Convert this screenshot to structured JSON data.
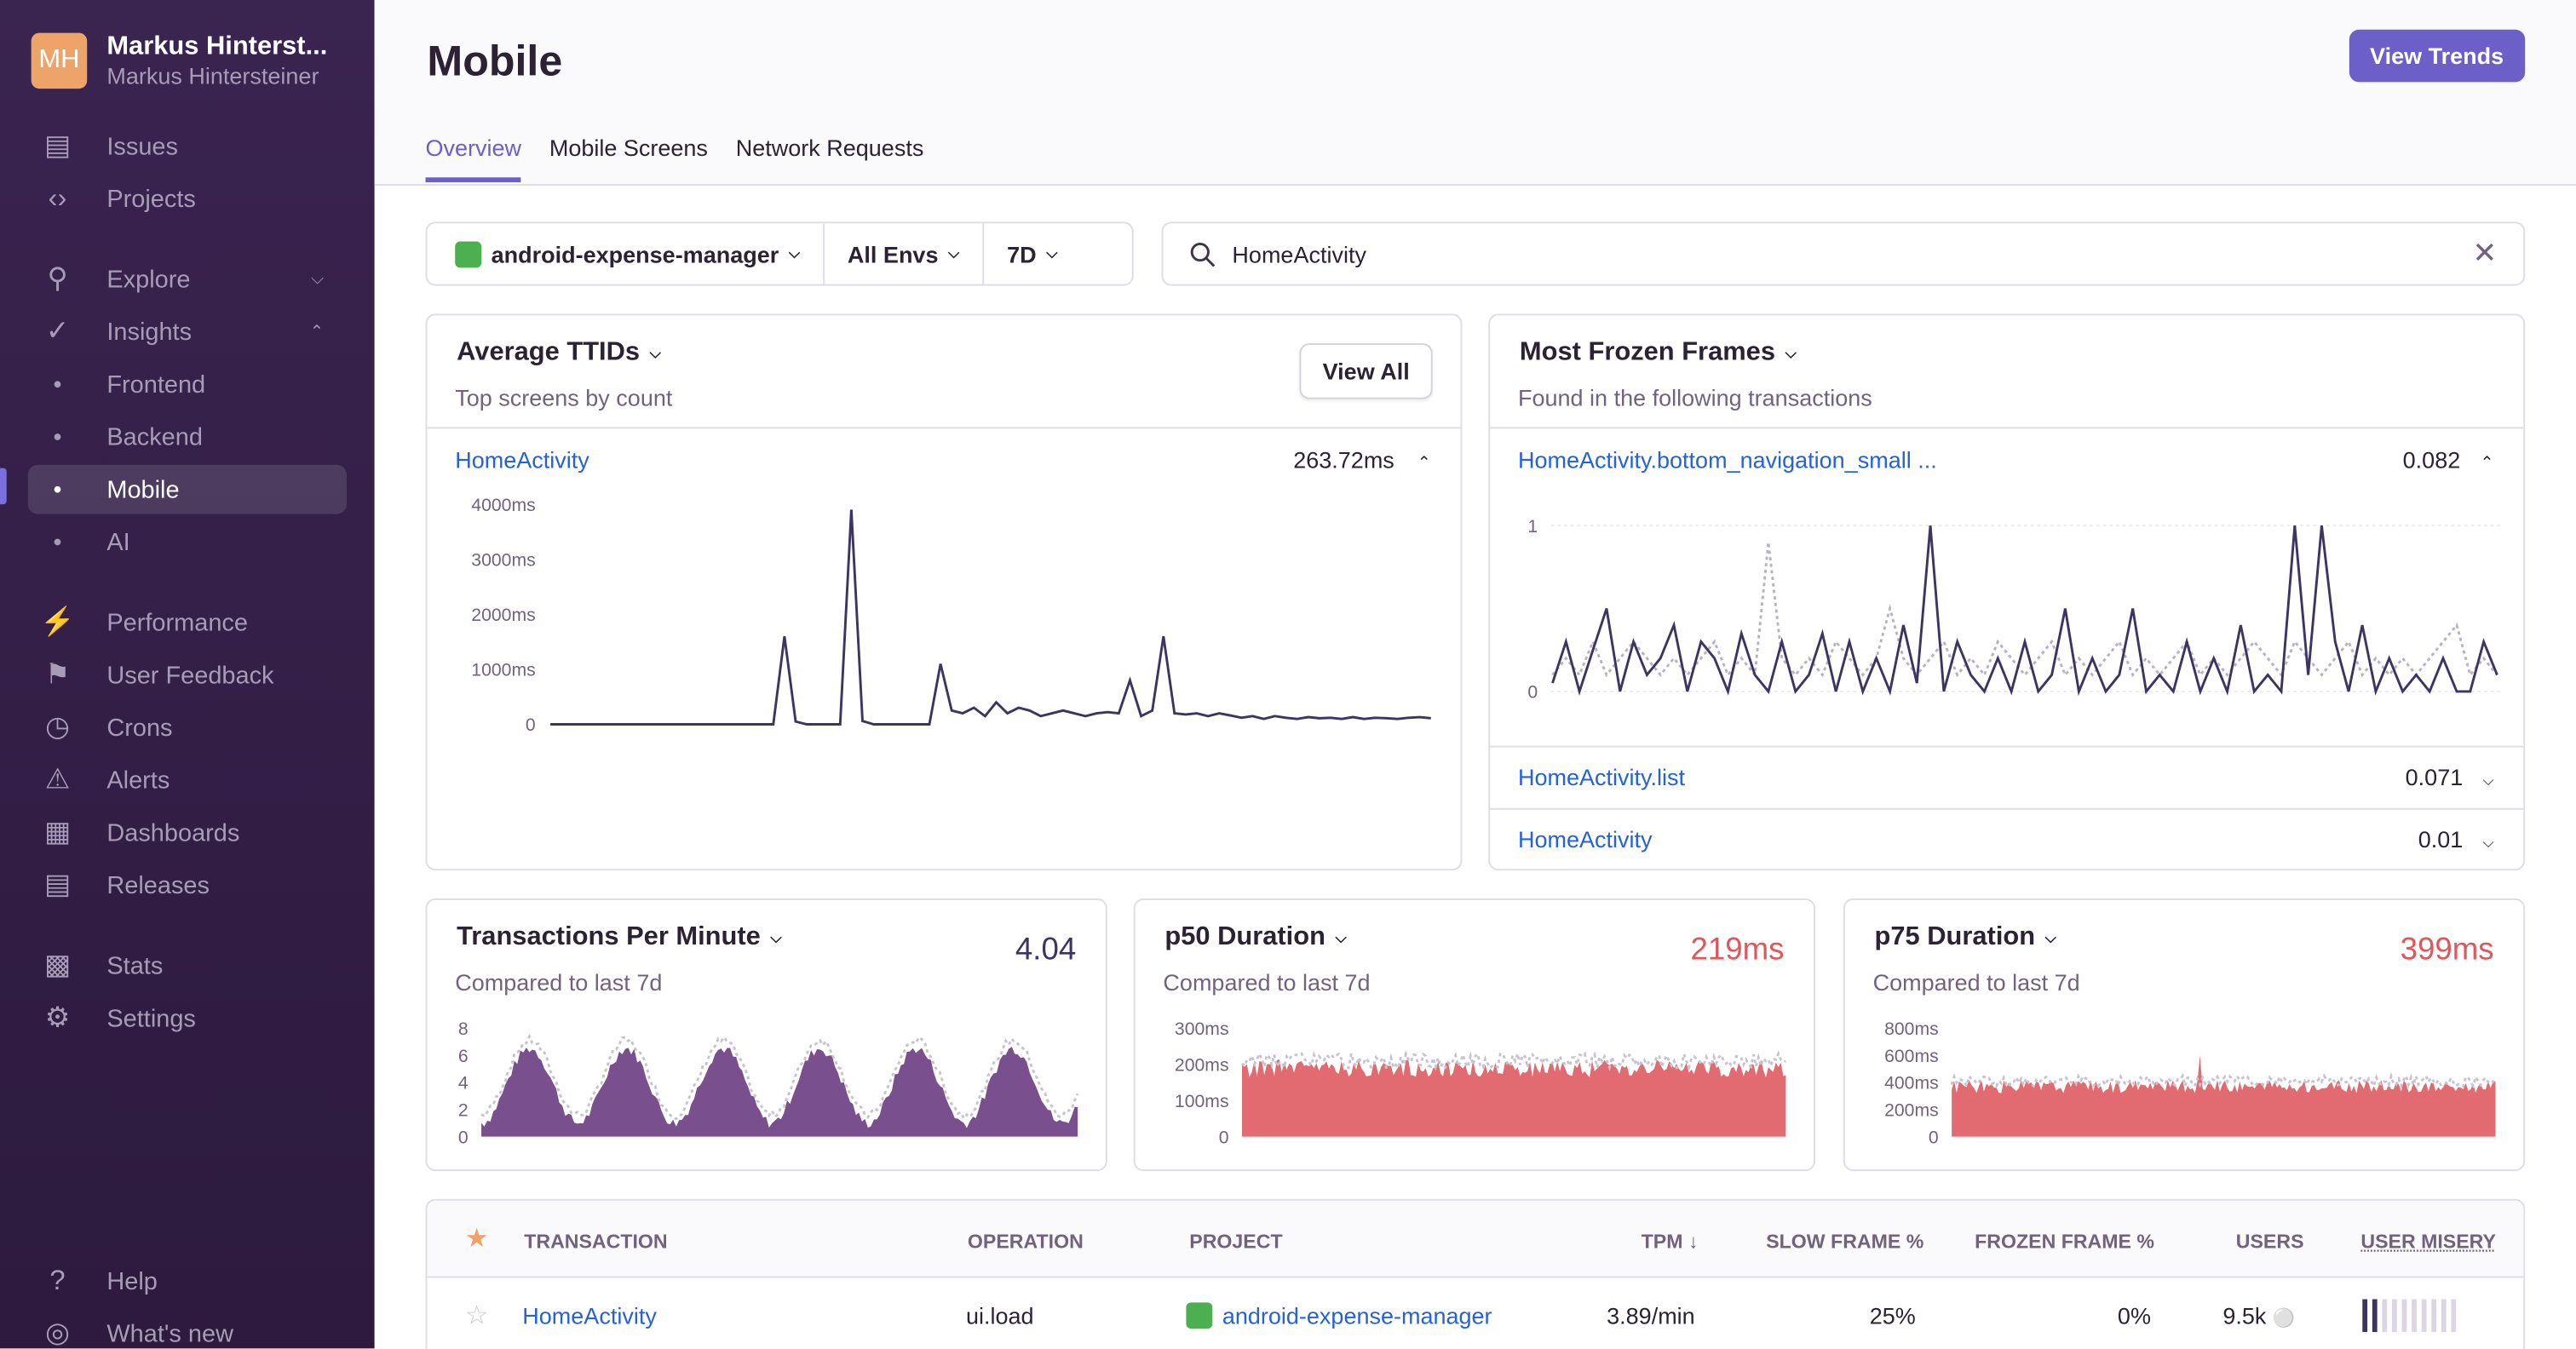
{
  "org": {
    "initials": "MH",
    "name": "Markus Hinterst...",
    "user": "Markus Hintersteiner"
  },
  "sidebar": {
    "items": [
      {
        "label": "Issues",
        "icon": "inbox-icon"
      },
      {
        "label": "Projects",
        "icon": "folder-code-icon"
      },
      {
        "label": "Explore",
        "icon": "search-icon",
        "chevron": "down"
      },
      {
        "label": "Insights",
        "icon": "insights-icon",
        "chevron": "up"
      },
      {
        "label": "Frontend",
        "sub": true
      },
      {
        "label": "Backend",
        "sub": true
      },
      {
        "label": "Mobile",
        "sub": true,
        "active": true
      },
      {
        "label": "AI",
        "sub": true
      },
      {
        "label": "Performance",
        "icon": "lightning-icon"
      },
      {
        "label": "User Feedback",
        "icon": "megaphone-icon"
      },
      {
        "label": "Crons",
        "icon": "history-icon"
      },
      {
        "label": "Alerts",
        "icon": "siren-icon"
      },
      {
        "label": "Dashboards",
        "icon": "dashboard-icon"
      },
      {
        "label": "Releases",
        "icon": "releases-icon"
      },
      {
        "label": "Stats",
        "icon": "stats-icon"
      },
      {
        "label": "Settings",
        "icon": "gear-icon"
      },
      {
        "label": "Help",
        "icon": "question-icon"
      },
      {
        "label": "What's new",
        "icon": "broadcast-icon"
      }
    ]
  },
  "header": {
    "title": "Mobile",
    "view_trends": "View Trends",
    "tabs": [
      "Overview",
      "Mobile Screens",
      "Network Requests"
    ],
    "selected_tab": "Overview"
  },
  "filters": {
    "project": "android-expense-manager",
    "env": "All Envs",
    "period": "7D"
  },
  "search": {
    "value": "HomeActivity"
  },
  "colors": {
    "accent": "#6c5fc7",
    "line": "#3e3460",
    "area_purple": "#7a4f8e",
    "area_red": "#e16b71",
    "red_value": "#e0575b",
    "link": "#2562d4"
  },
  "ttid": {
    "title": "Average TTIDs",
    "subtitle": "Top screens by count",
    "view_all": "View All",
    "row_label": "HomeActivity",
    "row_value": "263.72ms"
  },
  "frozen": {
    "title": "Most Frozen Frames",
    "subtitle": "Found in the following transactions",
    "rows": [
      {
        "label": "HomeActivity.bottom_navigation_small ...",
        "value": "0.082",
        "expanded": true
      },
      {
        "label": "HomeActivity.list",
        "value": "0.071"
      },
      {
        "label": "HomeActivity",
        "value": "0.01"
      }
    ]
  },
  "tpm": {
    "title": "Transactions Per Minute",
    "subtitle": "Compared to last 7d",
    "value": "4.04"
  },
  "p50": {
    "title": "p50 Duration",
    "subtitle": "Compared to last 7d",
    "value": "219ms"
  },
  "p75": {
    "title": "p75 Duration",
    "subtitle": "Compared to last 7d",
    "value": "399ms"
  },
  "table": {
    "headers": [
      "TRANSACTION",
      "OPERATION",
      "PROJECT",
      "TPM",
      "SLOW FRAME %",
      "FROZEN FRAME %",
      "USERS",
      "USER MISERY"
    ],
    "rows": [
      {
        "transaction": "HomeActivity",
        "operation": "ui.load",
        "project": "android-expense-manager",
        "tpm": "3.89/min",
        "slow": "25%",
        "frozen": "0%",
        "users": "9.5k",
        "misery_level": 0.2,
        "starred": false
      }
    ]
  },
  "chart_data": [
    {
      "type": "line",
      "id": "ttid",
      "yticks": [
        "4000ms",
        "3000ms",
        "2000ms",
        "1000ms",
        "0"
      ],
      "ylim": [
        0,
        4000
      ],
      "values": [
        0,
        0,
        0,
        0,
        0,
        0,
        0,
        0,
        0,
        0,
        0,
        0,
        0,
        0,
        0,
        0,
        0,
        0,
        0,
        0,
        0,
        1600,
        50,
        0,
        0,
        0,
        0,
        3900,
        60,
        0,
        0,
        0,
        0,
        0,
        0,
        1100,
        250,
        200,
        300,
        150,
        400,
        200,
        300,
        250,
        150,
        200,
        250,
        200,
        150,
        200,
        220,
        200,
        800,
        150,
        250,
        1600,
        200,
        180,
        200,
        150,
        200,
        160,
        120,
        150,
        100,
        150,
        120,
        100,
        130,
        110,
        120,
        100,
        130,
        100,
        120,
        110,
        100,
        120,
        130,
        110
      ]
    },
    {
      "type": "line",
      "id": "frozen",
      "yticks": [
        "1",
        "0"
      ],
      "ylim": [
        0,
        1
      ],
      "series": [
        {
          "values": [
            0.05,
            0.3,
            0,
            0.25,
            0.5,
            0,
            0.3,
            0.1,
            0.2,
            0.4,
            0,
            0.3,
            0.2,
            0,
            0.35,
            0.1,
            0,
            0.3,
            0,
            0.1,
            0.35,
            0,
            0.3,
            0,
            0.2,
            0,
            0.4,
            0.05,
            1,
            0,
            0.3,
            0.1,
            0,
            0.2,
            0,
            0.3,
            0,
            0.1,
            0.5,
            0,
            0.2,
            0,
            0.1,
            0.5,
            0,
            0.1,
            0,
            0.3,
            0,
            0.2,
            0,
            0.4,
            0,
            0.1,
            0,
            1,
            0.1,
            1,
            0.3,
            0,
            0.4,
            0,
            0.2,
            0,
            0.1,
            0,
            0.2,
            0,
            0,
            0.3,
            0.1
          ],
          "style": "solid"
        },
        {
          "values": [
            0.1,
            0.2,
            0.1,
            0.3,
            0.1,
            0.2,
            0.3,
            0.2,
            0.1,
            0.2,
            0.1,
            0.2,
            0.3,
            0.1,
            0.2,
            0.1,
            0.9,
            0.2,
            0.1,
            0.2,
            0.1,
            0.3,
            0.2,
            0.1,
            0.2,
            0.5,
            0.2,
            0.1,
            0.2,
            0.3,
            0.1,
            0.2,
            0.1,
            0.3,
            0.2,
            0.1,
            0.2,
            0.3,
            0.1,
            0.2,
            0.1,
            0.2,
            0.3,
            0.1,
            0.2,
            0.1,
            0.2,
            0.3,
            0.1,
            0.2,
            0.1,
            0.2,
            0.3,
            0.2,
            0.1,
            0.3,
            0.2,
            0.1,
            0.2,
            0.3,
            0.1,
            0.2,
            0.1,
            0.2,
            0.1,
            0.2,
            0.3,
            0.4,
            0.1,
            0.2,
            0.1
          ],
          "style": "dotted"
        }
      ]
    },
    {
      "type": "area",
      "id": "tpm",
      "yticks": [
        "8",
        "6",
        "4",
        "2",
        "0"
      ],
      "ylim": [
        0,
        8
      ],
      "period": "wave",
      "min": 1,
      "max": 6.5
    },
    {
      "type": "area",
      "id": "p50",
      "yticks": [
        "300ms",
        "200ms",
        "100ms",
        "0"
      ],
      "ylim": [
        0,
        300
      ],
      "level": 200
    },
    {
      "type": "area",
      "id": "p75",
      "yticks": [
        "800ms",
        "600ms",
        "400ms",
        "200ms",
        "0"
      ],
      "ylim": [
        0,
        800
      ],
      "level": 390
    }
  ]
}
